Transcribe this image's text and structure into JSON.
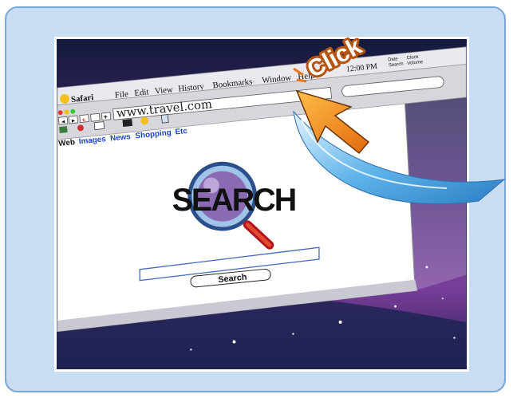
{
  "browser": {
    "app_name": "Safari",
    "menu": [
      "File",
      "Edit",
      "View",
      "History",
      "Bookmarks",
      "Window",
      "Help"
    ],
    "url": "www.travel.com",
    "nav_buttons": [
      "◄",
      "►",
      "c",
      "",
      "+"
    ],
    "categories": [
      "Web",
      "Images",
      "News",
      "Shopping",
      "Etc"
    ]
  },
  "menubar_extras": {
    "time": "12:00 PM",
    "date_search": [
      "Date",
      "Search"
    ],
    "clock_volume": [
      "Clock",
      "Volume"
    ]
  },
  "search_page": {
    "logo_text": "SEARCH",
    "search_value": "",
    "search_button": "Search"
  },
  "callout": {
    "text": "Click"
  },
  "colors": {
    "frame_border": "#7aa6d8",
    "frame_fill": "#c8dcf2",
    "desktop_purple": "#5b2a7e",
    "arrow_orange": "#f08a1e",
    "swoosh_blue": "#3f9ddc",
    "link_blue": "#1a44c8"
  }
}
